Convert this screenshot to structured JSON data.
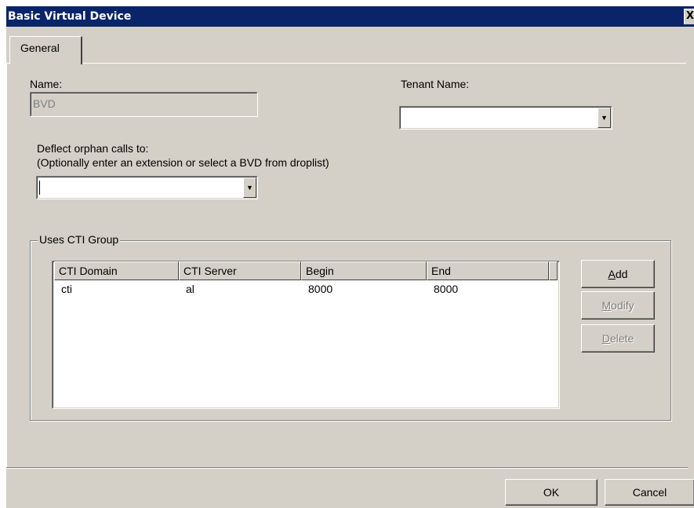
{
  "window": {
    "title": "Basic Virtual Device",
    "close_glyph": "X"
  },
  "tabs": [
    {
      "label": "General",
      "selected": true
    }
  ],
  "form": {
    "name_label": "Name:",
    "name_value": "BVD",
    "tenant_label": "Tenant Name:",
    "tenant_value": "",
    "deflect_label": "Deflect orphan calls to:",
    "deflect_hint": "(Optionally enter an extension or select a BVD from droplist)",
    "deflect_value": ""
  },
  "cti_group": {
    "label": "Uses CTI Group",
    "columns": [
      "CTI Domain",
      "CTI Server",
      "Begin",
      "End"
    ],
    "rows": [
      [
        "cti",
        "al",
        "8000",
        "8000"
      ]
    ],
    "buttons": {
      "add": {
        "mnemonic": "A",
        "rest": "dd",
        "enabled": true
      },
      "modify": {
        "mnemonic": "M",
        "rest": "odify",
        "enabled": false
      },
      "delete": {
        "mnemonic": "D",
        "rest": "elete",
        "enabled": false
      }
    }
  },
  "footer": {
    "ok_label": "OK",
    "cancel_label": "Cancel"
  },
  "colors": {
    "titlebar": "#0a246a",
    "face": "#d4d0c8",
    "disabled_text": "#808080"
  }
}
